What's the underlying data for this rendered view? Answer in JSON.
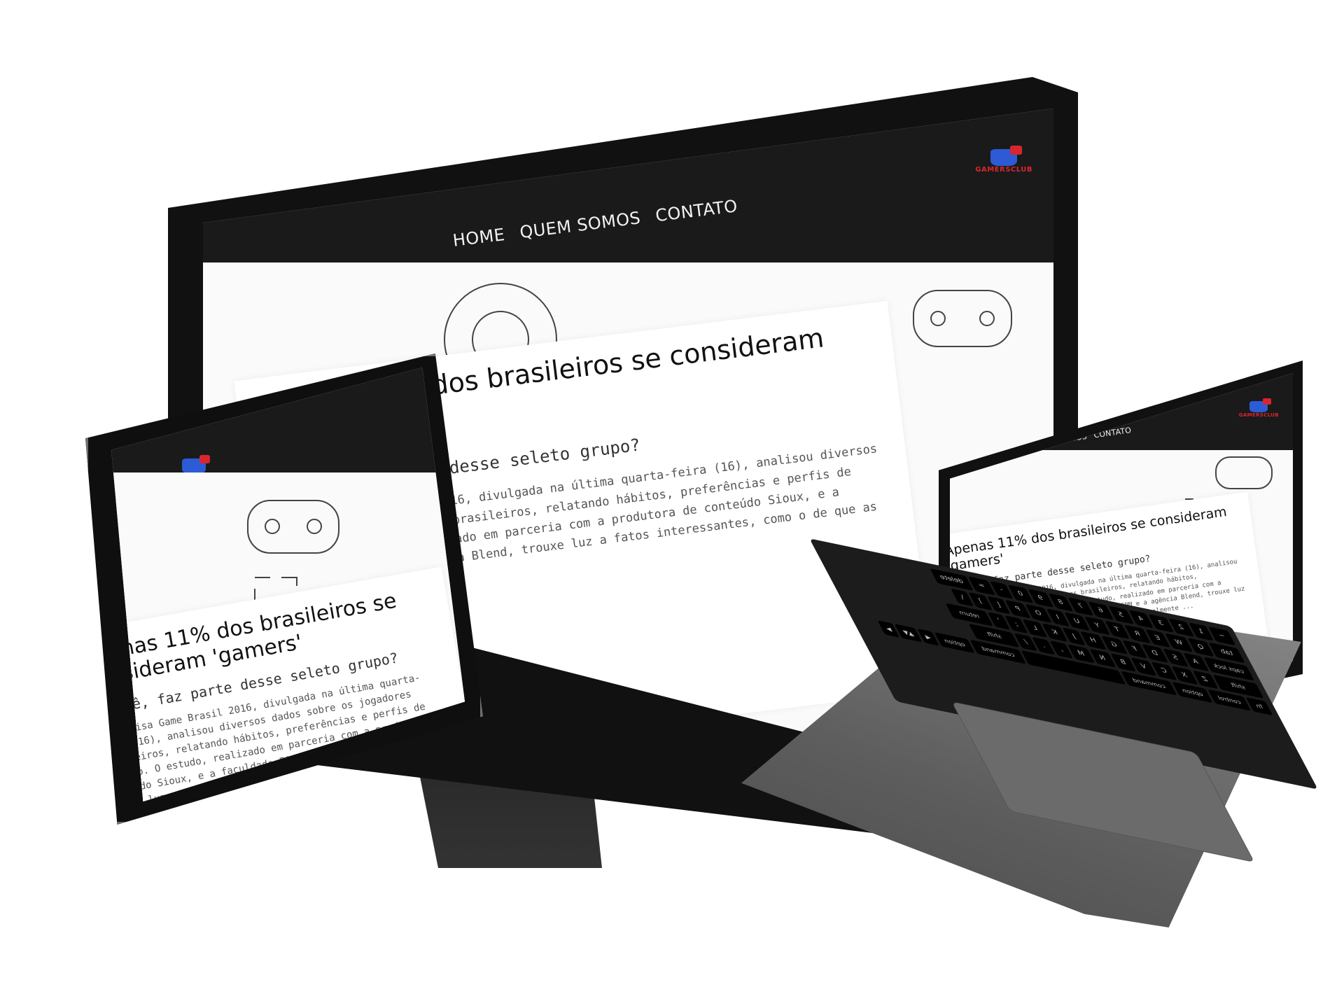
{
  "site": {
    "logo_text": "GAMERSCLUB",
    "nav": [
      "HOME",
      "QUEM SOMOS",
      "CONTATO"
    ],
    "headline": "Apenas 11% dos brasileiros se consideram 'gamers'",
    "subheadline": "E você, faz parte desse seleto grupo?",
    "body": "A Pesquisa Game Brasil 2016, divulgada na última quarta-feira (16), analisou diversos dados sobre os jogadores brasileiros, relatando hábitos, preferências e perfis de consumo. O estudo, realizado em parceria com a produtora de conteúdo Sioux, e a faculdade ESPM e a agência Blend, trouxe luz a fatos interessantes, como o de que as mulheres atualmente ..."
  },
  "laptop_keys": {
    "row1": [
      "esc",
      "",
      "",
      "",
      "",
      "",
      "",
      "",
      "",
      "",
      "",
      "",
      "",
      ""
    ],
    "row2": [
      "~",
      "1",
      "2",
      "3",
      "4",
      "5",
      "6",
      "7",
      "8",
      "9",
      "0",
      "-",
      "=",
      "delete"
    ],
    "row3": [
      "tab",
      "Q",
      "W",
      "E",
      "R",
      "T",
      "Y",
      "U",
      "I",
      "O",
      "P",
      "[",
      "]",
      "\\"
    ],
    "row4": [
      "caps lock",
      "A",
      "S",
      "D",
      "F",
      "G",
      "H",
      "J",
      "K",
      "L",
      ";",
      "'",
      "return"
    ],
    "row5": [
      "shift",
      "Z",
      "X",
      "C",
      "V",
      "B",
      "N",
      "M",
      ",",
      ".",
      "/",
      "shift"
    ],
    "row6": [
      "fn",
      "control",
      "option",
      "command",
      "",
      "command",
      "option",
      "◀",
      "▲▼",
      "▶"
    ]
  }
}
